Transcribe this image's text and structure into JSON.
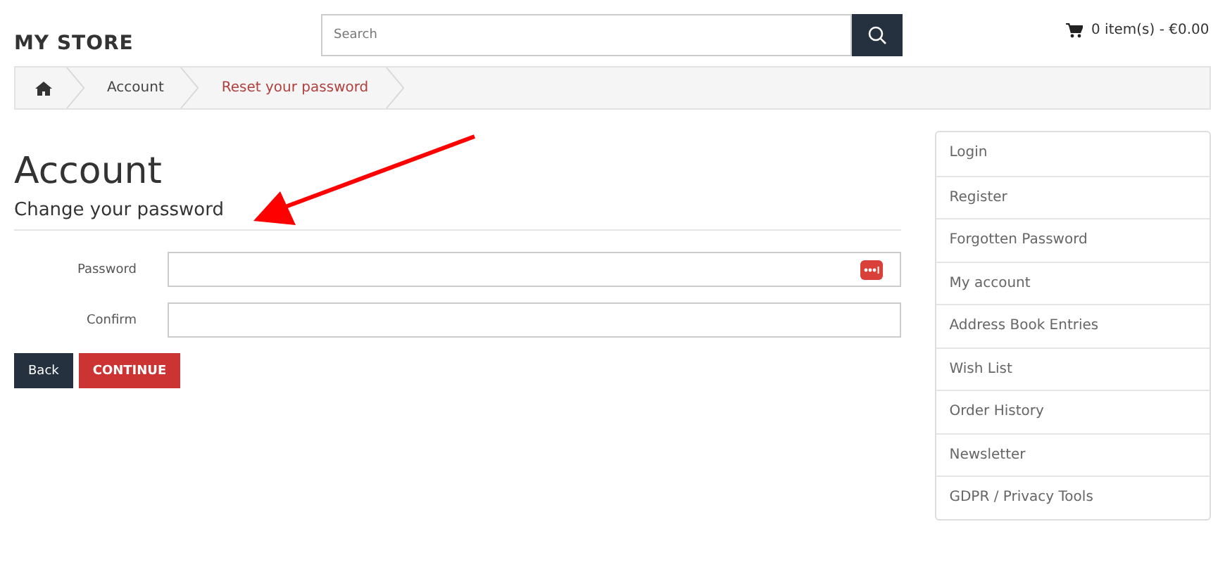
{
  "header": {
    "logo": "MY STORE",
    "search": {
      "placeholder": "Search"
    },
    "cart": "0 item(s) - €0.00"
  },
  "breadcrumb": [
    {
      "kind": "home"
    },
    {
      "kind": "link",
      "label": "Account",
      "selected": false
    },
    {
      "kind": "link",
      "label": "Reset your password",
      "selected": true
    }
  ],
  "page": {
    "title": "Account",
    "subtitle": "Change your password"
  },
  "form": [
    {
      "label": "Password",
      "password_manager": true
    },
    {
      "label": "Confirm",
      "password_manager": false
    }
  ],
  "buttons": [
    {
      "kind": "back",
      "label": "Back"
    },
    {
      "kind": "primary",
      "label": "CONTINUE"
    }
  ],
  "sidebar": {
    "items": [
      {
        "label": "Login"
      },
      {
        "label": "Register"
      },
      {
        "label": "Forgotten Password"
      },
      {
        "label": "My account"
      },
      {
        "label": "Address Book Entries"
      },
      {
        "label": "Wish List"
      },
      {
        "label": "Order History"
      },
      {
        "label": "Newsletter"
      },
      {
        "label": "GDPR / Privacy Tools"
      }
    ]
  },
  "annotation": {
    "kind": "arrow"
  }
}
